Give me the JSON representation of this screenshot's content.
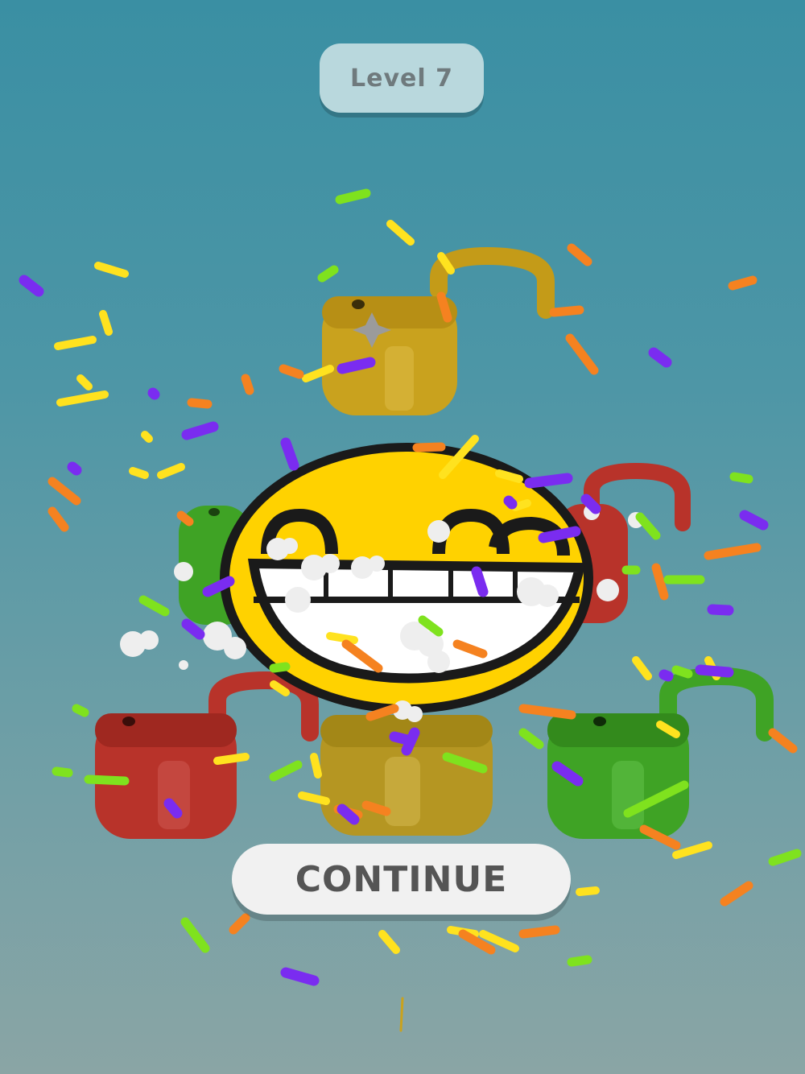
{
  "header": {
    "level_label": "Level 7"
  },
  "actions": {
    "continue_label": "CONTINUE"
  },
  "emoji": {
    "name": "grinning-face-icon",
    "color": "#ffd200"
  },
  "locks": [
    {
      "name": "yellow-padlock-icon",
      "color": "#c9a21e",
      "state": "open"
    },
    {
      "name": "green-padlock-icon",
      "color": "#3fa325",
      "state": "open"
    },
    {
      "name": "red-padlock-icon",
      "color": "#b8332a",
      "state": "open"
    },
    {
      "name": "red-padlock-icon",
      "color": "#b8332a",
      "state": "open"
    },
    {
      "name": "yellow-padlock-icon",
      "color": "#c9a21e",
      "state": "open"
    },
    {
      "name": "green-padlock-icon",
      "color": "#3fa325",
      "state": "open"
    }
  ],
  "confetti_colors": [
    "#ffe21f",
    "#f58220",
    "#7a2cf0",
    "#7fe21e"
  ]
}
